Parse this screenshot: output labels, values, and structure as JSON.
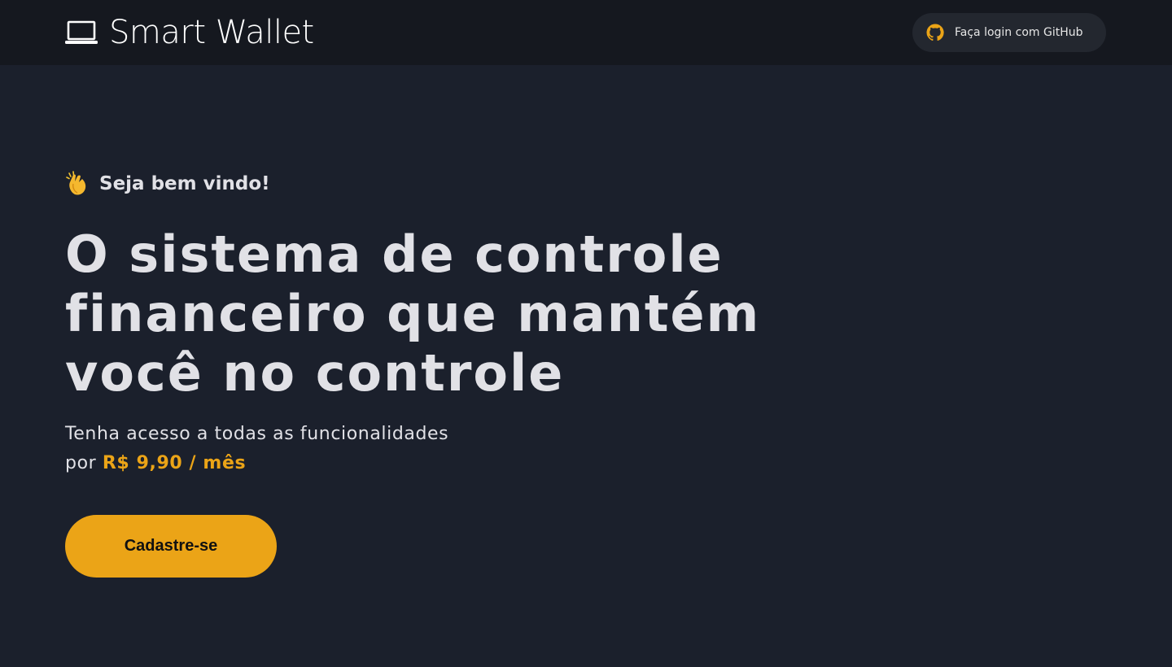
{
  "header": {
    "brand_name": "Smart Wallet",
    "brand_icon": "laptop-icon",
    "login_label": "Faça login com GitHub",
    "login_icon": "github-icon"
  },
  "hero": {
    "welcome_icon": "clapping-hands-icon",
    "welcome_text": "Seja bem vindo!",
    "headline": "O sistema de controle financeiro que mantém você no controle",
    "subtitle_line1": "Tenha acesso a todas as funcionalidades",
    "subtitle_prefix": "por",
    "price": "R$ 9,90 / mês",
    "cta_label": "Cadastre-se"
  },
  "colors": {
    "background": "#1b202c",
    "header": "#15181f",
    "accent": "#eba417",
    "text": "#e1e1e6",
    "login_button": "#23272f"
  }
}
